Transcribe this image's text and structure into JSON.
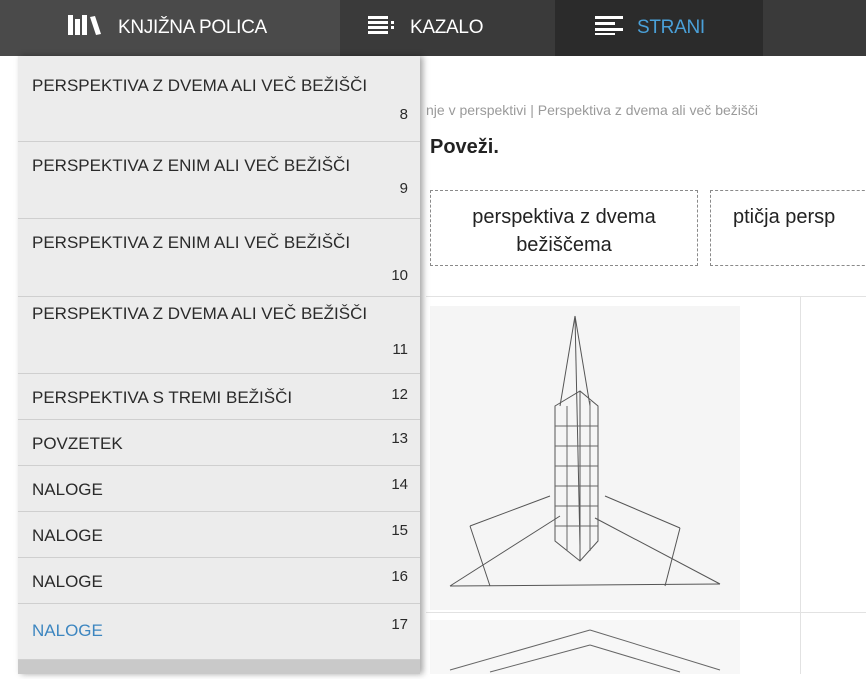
{
  "topbar": {
    "bookshelf_label": "KNJIŽNA POLICA",
    "toc_label": "KAZALO",
    "pages_label": "STRANI"
  },
  "content": {
    "breadcrumb": "nje v perspektivi | Perspektiva z dvema ali več bežišči",
    "prompt": "Poveži.",
    "option1": "perspektiva z dvema bežiščema",
    "option2": "ptičja persp"
  },
  "pages_menu": [
    {
      "title": "PERSPEKTIVA Z DVEMA ALI VEČ BEŽIŠČI",
      "page": "8"
    },
    {
      "title": "PERSPEKTIVA Z ENIM ALI VEČ BEŽIŠČI",
      "page": "9"
    },
    {
      "title": "PERSPEKTIVA Z ENIM ALI VEČ BEŽIŠČI",
      "page": "10"
    },
    {
      "title": "PERSPEKTIVA Z DVEMA ALI VEČ BEŽIŠČI",
      "page": "11"
    },
    {
      "title": "PERSPEKTIVA S TREMI BEŽIŠČI",
      "page": "12"
    },
    {
      "title": "POVZETEK",
      "page": "13"
    },
    {
      "title": "NALOGE",
      "page": "14"
    },
    {
      "title": "NALOGE",
      "page": "15"
    },
    {
      "title": "NALOGE",
      "page": "16"
    },
    {
      "title": "NALOGE",
      "page": "17"
    }
  ],
  "colors": {
    "accent": "#4aa0d8",
    "active_item": "#3d86c0",
    "topbar": "#3a3a3a"
  },
  "icons": [
    "bookshelf-icon",
    "toc-list-icon",
    "pages-icon"
  ]
}
